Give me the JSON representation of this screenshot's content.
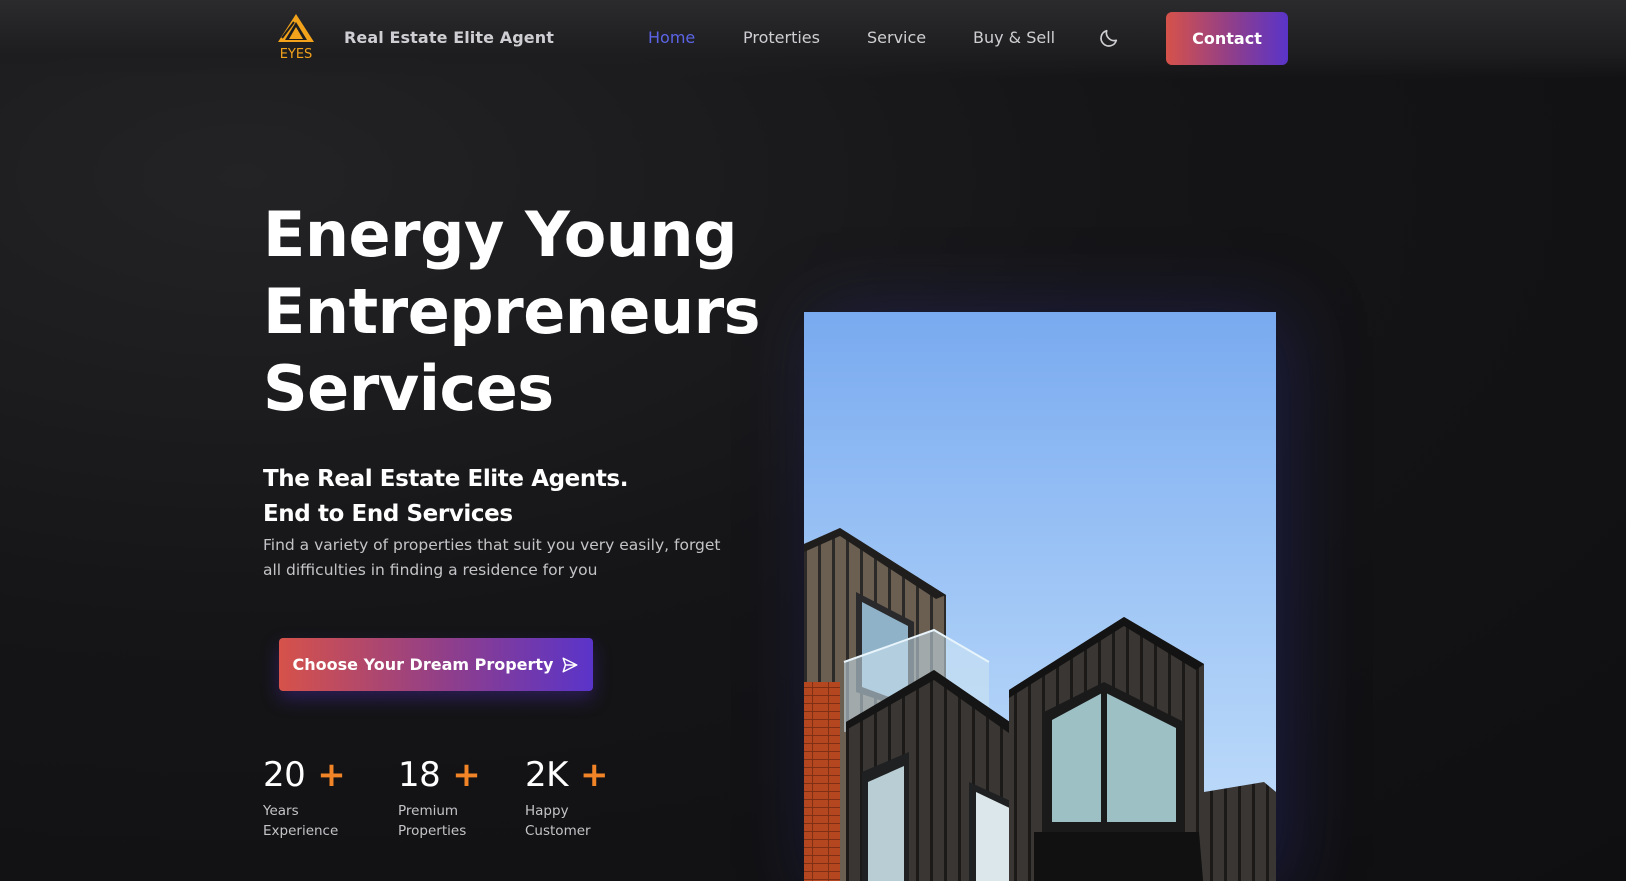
{
  "header": {
    "logo_text": "EYES",
    "brand": "Real Estate Elite Agent",
    "nav": [
      {
        "label": "Home",
        "active": true
      },
      {
        "label": "Proterties",
        "active": false
      },
      {
        "label": "Service",
        "active": false
      },
      {
        "label": "Buy & Sell",
        "active": false
      }
    ],
    "theme_icon": "moon-icon",
    "contact_label": "Contact"
  },
  "hero": {
    "title_lines": [
      "Energy Young",
      "Entrepreneurs",
      "Services"
    ],
    "subtitle_lines": [
      "The Real Estate Elite Agents.",
      "End to End Services"
    ],
    "description": "Find a variety of properties that suit you very easily, forget all difficulties in finding a residence for you",
    "cta_label": "Choose Your Dream Property",
    "cta_icon": "send-icon"
  },
  "stats": [
    {
      "value": "20",
      "plus": "+",
      "label_lines": [
        "Years",
        "Experience"
      ]
    },
    {
      "value": "18",
      "plus": "+",
      "label_lines": [
        "Premium",
        "Properties"
      ]
    },
    {
      "value": "2K",
      "plus": "+",
      "label_lines": [
        "Happy",
        "Customer"
      ]
    }
  ],
  "colors": {
    "accent_nav": "#5b64e6",
    "plus": "#f08427",
    "gradient_start": "#d6524a",
    "gradient_end": "#5a34c9"
  }
}
